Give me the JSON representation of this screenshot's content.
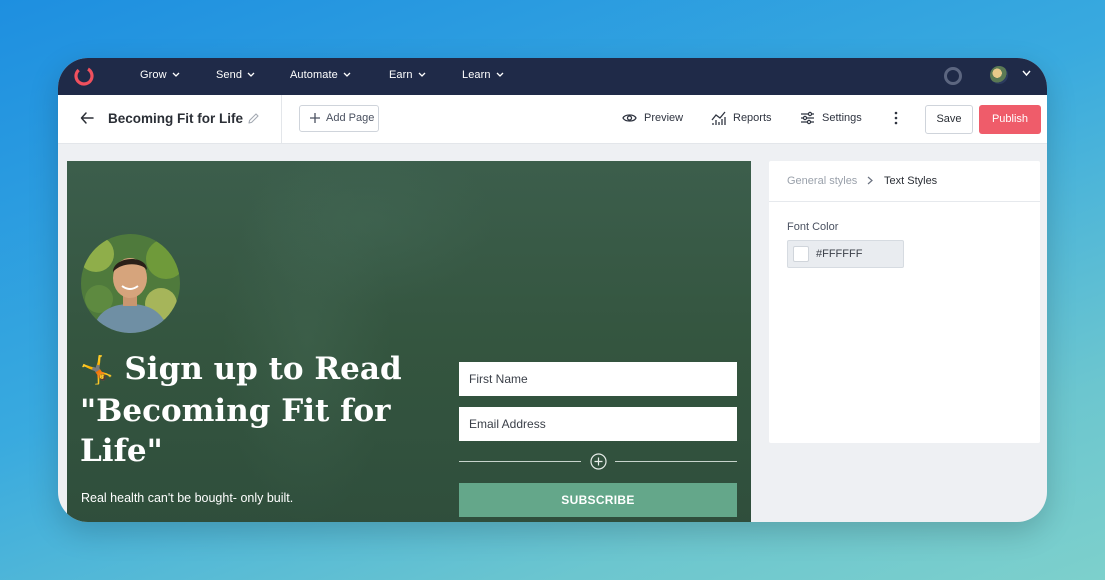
{
  "nav": {
    "items": [
      {
        "label": "Grow"
      },
      {
        "label": "Send"
      },
      {
        "label": "Automate"
      },
      {
        "label": "Earn"
      },
      {
        "label": "Learn"
      }
    ]
  },
  "toolbar": {
    "page_title": "Becoming Fit for Life",
    "add_page_label": "Add Page",
    "preview_label": "Preview",
    "reports_label": "Reports",
    "settings_label": "Settings",
    "save_label": "Save",
    "publish_label": "Publish"
  },
  "landing": {
    "headline_emoji": "🤸",
    "headline": "Sign up to Read \"Becoming Fit for Life\"",
    "subtext": "Real health can't be bought- only built.",
    "first_name_placeholder": "First Name",
    "email_placeholder": "Email Address",
    "subscribe_label": "SUBSCRIBE"
  },
  "panel": {
    "breadcrumb_parent": "General styles",
    "breadcrumb_current": "Text Styles",
    "font_color_label": "Font Color",
    "font_color_value": "#FFFFFF"
  },
  "colors": {
    "nav_bg": "#1f2a48",
    "brand_red": "#ef5c6a",
    "subscribe_green": "#64a78a",
    "canvas_green": "#34553f"
  }
}
